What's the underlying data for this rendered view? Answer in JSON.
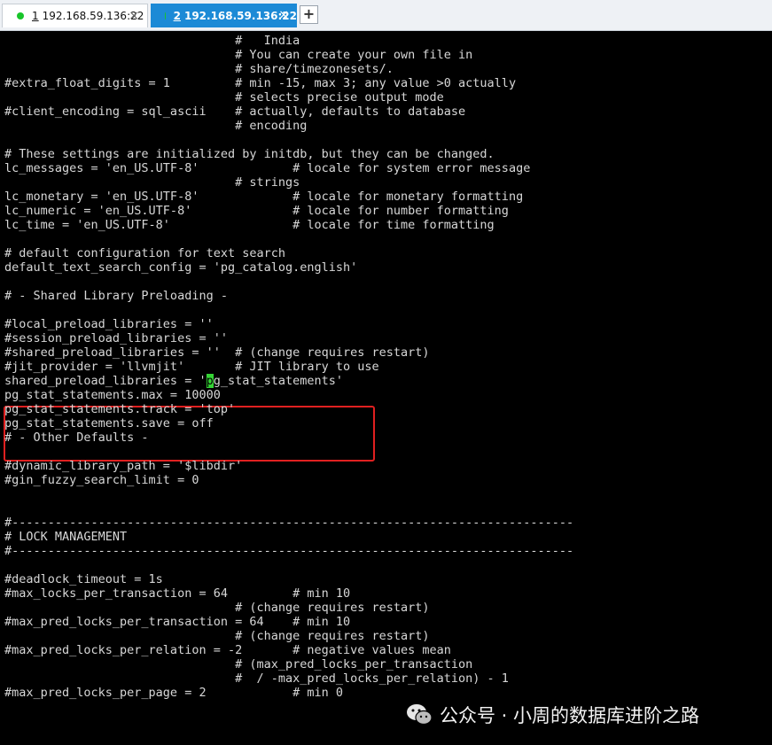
{
  "tabs": [
    {
      "number": "1",
      "title": "192.168.59.136:22",
      "close": "×"
    },
    {
      "number": "2",
      "title": "192.168.59.136:22",
      "close": "×"
    }
  ],
  "new_tab_label": "+",
  "terminal": {
    "lines": [
      "                                #   India",
      "                                # You can create your own file in",
      "                                # share/timezonesets/.",
      "#extra_float_digits = 1         # min -15, max 3; any value >0 actually",
      "                                # selects precise output mode",
      "#client_encoding = sql_ascii    # actually, defaults to database",
      "                                # encoding",
      "",
      "# These settings are initialized by initdb, but they can be changed.",
      "lc_messages = 'en_US.UTF-8'             # locale for system error message",
      "                                # strings",
      "lc_monetary = 'en_US.UTF-8'             # locale for monetary formatting",
      "lc_numeric = 'en_US.UTF-8'              # locale for number formatting",
      "lc_time = 'en_US.UTF-8'                 # locale for time formatting",
      "",
      "# default configuration for text search",
      "default_text_search_config = 'pg_catalog.english'",
      "",
      "# - Shared Library Preloading -",
      "",
      "#local_preload_libraries = ''",
      "#session_preload_libraries = ''",
      "#shared_preload_libraries = ''  # (change requires restart)",
      "#jit_provider = 'llvmjit'       # JIT library to use",
      "shared_preload_libraries = 'pg_stat_statements'",
      "pg_stat_statements.max = 10000",
      "pg_stat_statements.track = 'top'",
      "pg_stat_statements.save = off",
      "# - Other Defaults -",
      "",
      "#dynamic_library_path = '$libdir'",
      "#gin_fuzzy_search_limit = 0",
      "",
      "",
      "#------------------------------------------------------------------------------",
      "# LOCK MANAGEMENT",
      "#------------------------------------------------------------------------------",
      "",
      "#deadlock_timeout = 1s",
      "#max_locks_per_transaction = 64         # min 10",
      "                                # (change requires restart)",
      "#max_pred_locks_per_transaction = 64    # min 10",
      "                                # (change requires restart)",
      "#max_pred_locks_per_relation = -2       # negative values mean",
      "                                # (max_pred_locks_per_transaction",
      "                                #  / -max_pred_locks_per_relation) - 1",
      "#max_pred_locks_per_page = 2            # min 0"
    ]
  },
  "cursor_line": {
    "before": "shared_preload_libraries = '",
    "cursor": "p",
    "after": "g_stat_statements'"
  },
  "watermark": {
    "text": "公众号 · 小周的数据库进阶之路",
    "icon": "wechat-icon"
  },
  "colors": {
    "terminal_bg": "#000000",
    "terminal_fg": "#d7d7d7",
    "cursor": "#35d435",
    "active_tab": "#1c8ad6",
    "highlight_box": "#e02020",
    "status_dot": "#18c52a"
  }
}
